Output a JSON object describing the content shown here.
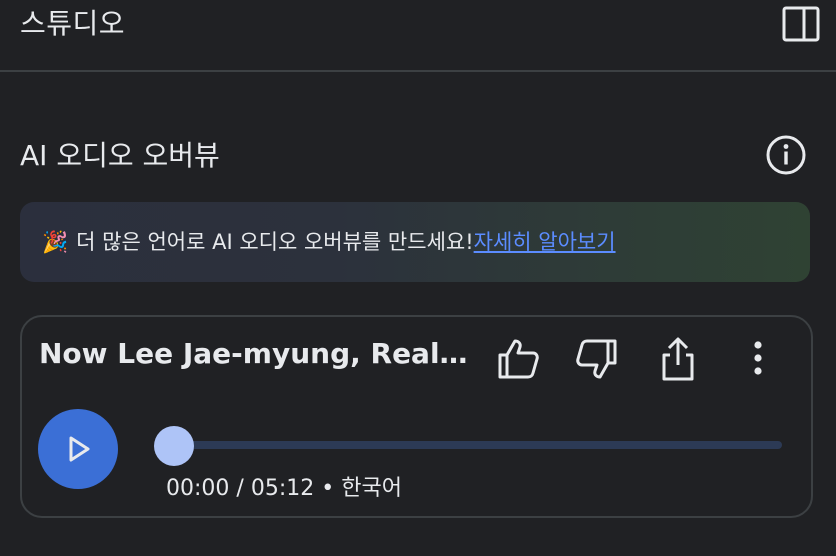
{
  "header": {
    "title": "스튜디오",
    "panel_toggle_icon": "side-panel-icon"
  },
  "section": {
    "title": "AI 오디오 오버뷰",
    "info_icon": "info-icon"
  },
  "banner": {
    "emoji": "🎉",
    "text": "더 많은 언어로 AI 오디오 오버뷰를 만드세요!",
    "link": "자세히 알아보기"
  },
  "player": {
    "title": "Now Lee Jae-myung, Real Estate Politics",
    "actions": [
      "thumbs-up-icon",
      "thumbs-down-icon",
      "share-icon",
      "more-vert-icon"
    ],
    "current_time": "00:00",
    "separator": "/",
    "duration": "05:12",
    "dot": "•",
    "language": "한국어",
    "progress": 0,
    "colors": {
      "play": "#3b6fd6",
      "thumb": "#aec4f7",
      "track": "#2c3a55"
    }
  }
}
